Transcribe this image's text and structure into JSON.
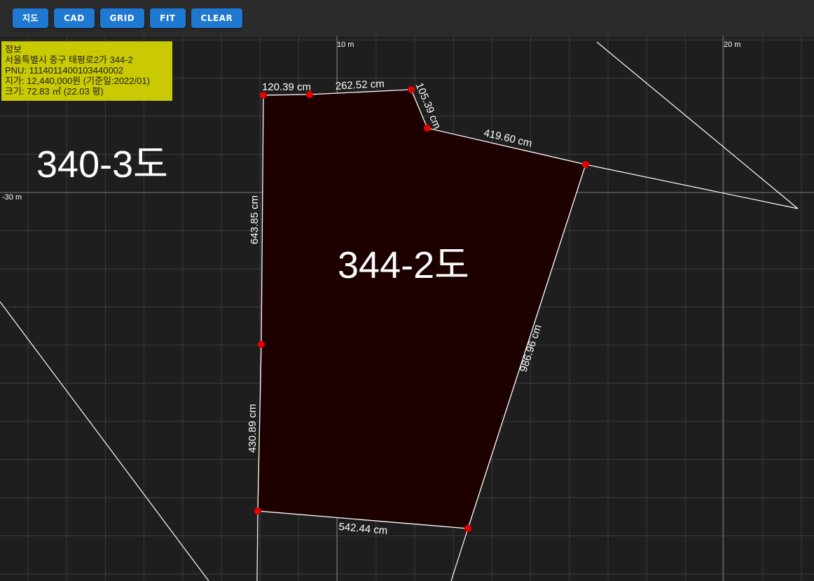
{
  "toolbar": {
    "buttons": [
      "지도",
      "CAD",
      "GRID",
      "FIT",
      "CLEAR"
    ]
  },
  "info": {
    "title": "정보",
    "address": "서울특별시 중구 태평로2가 344-2",
    "pnu": "PNU: 1114011400103440002",
    "price": "지가: 12,440,000원 (기준일:2022/01)",
    "size": "크기: 72.83 ㎡ (22.03 평)"
  },
  "axes": {
    "x_label_1": "10 m",
    "x_label_2": "20 m",
    "y_label_1": "-30 m"
  },
  "parcels": {
    "main_label": "344-2도",
    "neighbor_label": "340-3도"
  },
  "dimensions": [
    "120.39 cm",
    "262.52 cm",
    "105.39 cm",
    "419.60 cm",
    "986.96 cm",
    "542.44 cm",
    "430.89 cm",
    "643.85 cm"
  ],
  "colors": {
    "button": "#1f78d1",
    "info_bg": "#c9c904",
    "parcel_fill": "#1d0000",
    "vertex": "#e60000",
    "grid": "#3c3c3c",
    "axis": "#7a7a7a"
  }
}
